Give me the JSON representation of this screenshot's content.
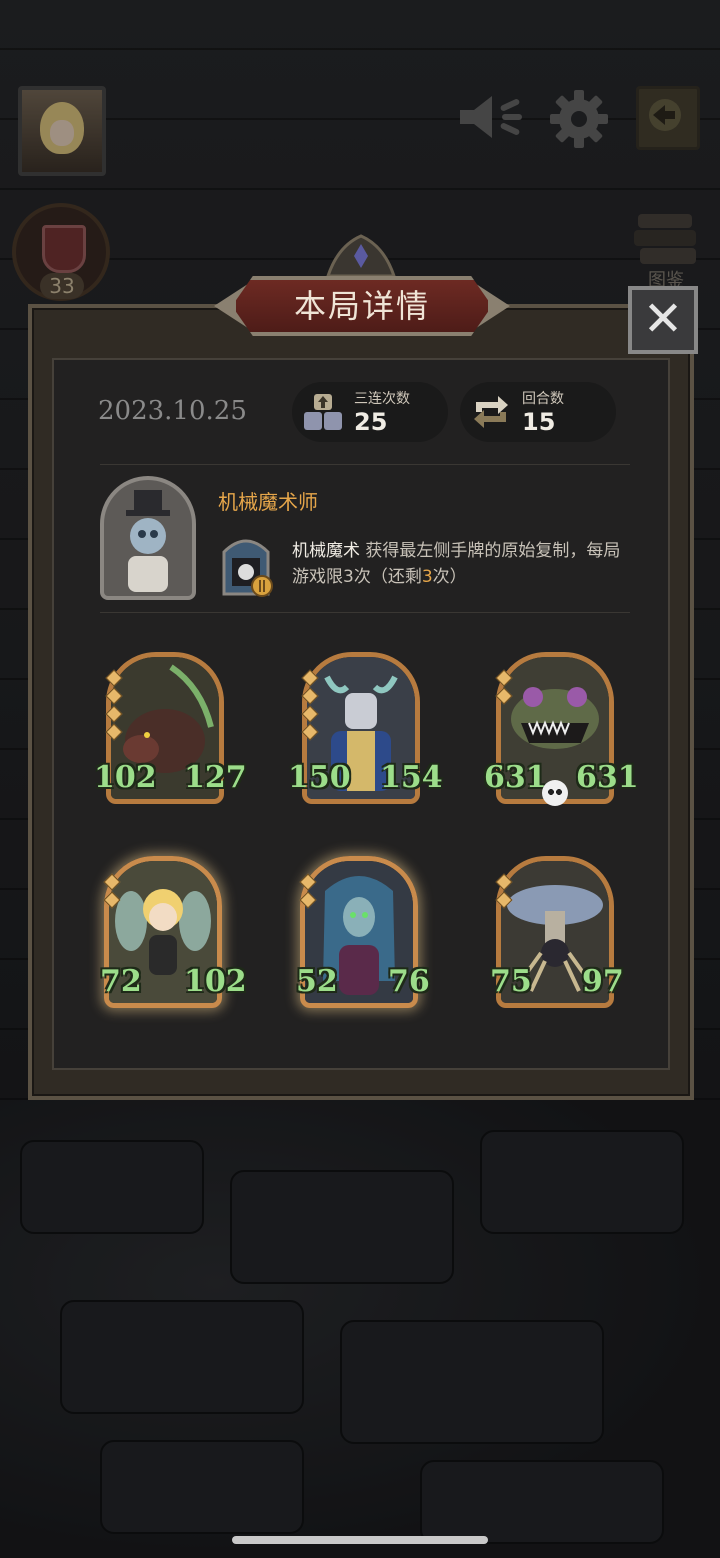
{
  "top_bar": {
    "crown_count": "33",
    "book_label": "图鉴"
  },
  "modal": {
    "title": "本局详情",
    "close_glyph": "✕",
    "date": "2023.10.25",
    "stats": [
      {
        "label": "三连次数",
        "value": "25"
      },
      {
        "label": "回合数",
        "value": "15"
      }
    ],
    "hero": {
      "name": "机械魔术师",
      "skill_name": "机械魔术",
      "skill_desc_a": " 获得最左侧手牌的原始复制，每局游戏限3次（还剩",
      "skill_remaining": "3",
      "skill_desc_b": "次）"
    },
    "cards": [
      {
        "name": "boar",
        "attack": "102",
        "health": "127",
        "pips": 4,
        "glow": false
      },
      {
        "name": "knight",
        "attack": "150",
        "health": "154",
        "pips": 4,
        "glow": false
      },
      {
        "name": "plant-monster",
        "attack": "631",
        "health": "631",
        "pips": 2,
        "glow": false
      },
      {
        "name": "fairy",
        "attack": "72",
        "health": "102",
        "pips": 2,
        "glow": true
      },
      {
        "name": "elf-sorceress",
        "attack": "52",
        "health": "76",
        "pips": 2,
        "glow": true
      },
      {
        "name": "mushroom-spider",
        "attack": "75",
        "health": "97",
        "pips": 2,
        "glow": false
      }
    ]
  },
  "colors": {
    "accent_orange": "#e6a64a",
    "stat_green": "#9cdd8a",
    "card_border": "#b77b3f",
    "title_red": "#6d2a23"
  }
}
